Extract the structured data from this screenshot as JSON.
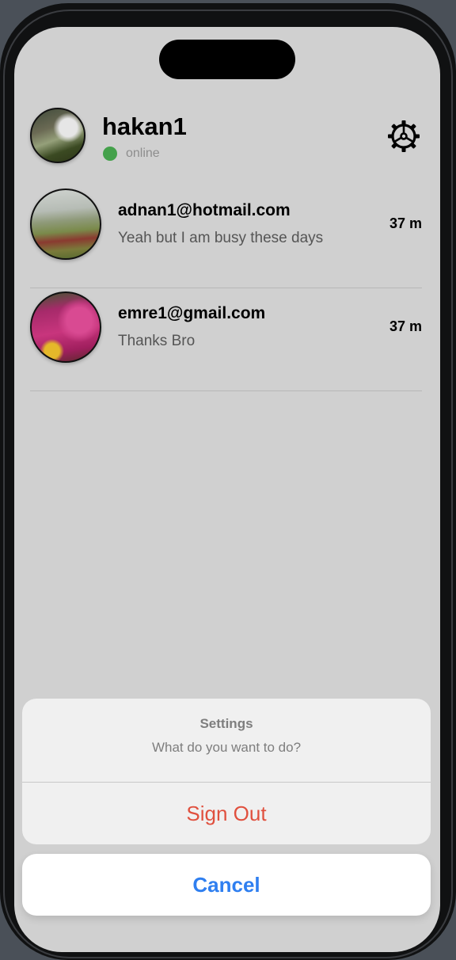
{
  "colors": {
    "screen_background": "#d0d0d0",
    "online_status": "#44a14b",
    "destructive": "#e0503e",
    "cancel_accent": "#2f7ff0"
  },
  "header": {
    "username": "hakan1",
    "status": "online",
    "settings_icon": "gear-icon"
  },
  "chats": [
    {
      "name": "adnan1@hotmail.com",
      "message": "Yeah but I am busy these days",
      "time": "37 m"
    },
    {
      "name": "emre1@gmail.com",
      "message": "Thanks Bro",
      "time": "37 m"
    }
  ],
  "action_sheet": {
    "title": "Settings",
    "message": "What do you want to do?",
    "sign_out_label": "Sign Out",
    "cancel_label": "Cancel"
  }
}
